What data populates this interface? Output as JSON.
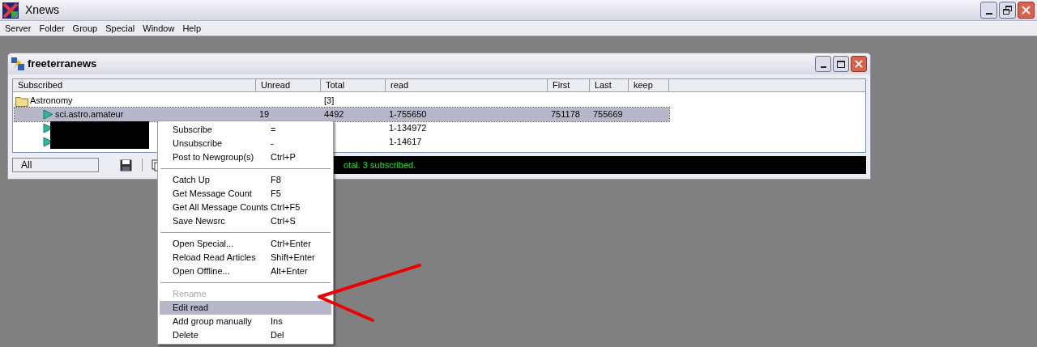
{
  "window": {
    "title": "Xnews"
  },
  "menubar": [
    "Server",
    "Folder",
    "Group",
    "Special",
    "Window",
    "Help"
  ],
  "child_window": {
    "title": "freeterranews"
  },
  "table": {
    "columns": [
      "Subscribed",
      "Unread",
      "Total",
      "read",
      "First",
      "Last",
      "keep"
    ],
    "rows": [
      {
        "kind": "folder",
        "name": "Astronomy",
        "total": "[3]",
        "selected": false
      },
      {
        "kind": "group",
        "name": "sci.astro.amateur",
        "unread": "19",
        "total": "4492",
        "read": "1-755650",
        "first": "751178",
        "last": "755669",
        "selected": true
      },
      {
        "kind": "group",
        "redacted": true,
        "read": "1-134972",
        "selected": false
      },
      {
        "kind": "group",
        "redacted": true,
        "read": "1-14617",
        "selected": false
      }
    ]
  },
  "toolbar": {
    "filter": "All"
  },
  "status_bar": "otal. 3 subscribed.",
  "context_menu": [
    {
      "kind": "item",
      "label": "Subscribe",
      "shortcut": "=",
      "disabled": false,
      "selected": false
    },
    {
      "kind": "item",
      "label": "Unsubscribe",
      "shortcut": "-",
      "disabled": false,
      "selected": false
    },
    {
      "kind": "item",
      "label": "Post to Newgroup(s)",
      "shortcut": "Ctrl+P",
      "disabled": false,
      "selected": false
    },
    {
      "kind": "separator"
    },
    {
      "kind": "item",
      "label": "Catch Up",
      "shortcut": "F8",
      "disabled": false,
      "selected": false
    },
    {
      "kind": "item",
      "label": "Get Message Count",
      "shortcut": "F5",
      "disabled": false,
      "selected": false
    },
    {
      "kind": "item",
      "label": "Get All Message Counts",
      "shortcut": "Ctrl+F5",
      "disabled": false,
      "selected": false
    },
    {
      "kind": "item",
      "label": "Save Newsrc",
      "shortcut": "Ctrl+S",
      "disabled": false,
      "selected": false
    },
    {
      "kind": "separator"
    },
    {
      "kind": "item",
      "label": "Open Special...",
      "shortcut": "Ctrl+Enter",
      "disabled": false,
      "selected": false
    },
    {
      "kind": "item",
      "label": "Reload Read Articles",
      "shortcut": "Shift+Enter",
      "disabled": false,
      "selected": false
    },
    {
      "kind": "item",
      "label": "Open Offline...",
      "shortcut": "Alt+Enter",
      "disabled": false,
      "selected": false
    },
    {
      "kind": "separator"
    },
    {
      "kind": "item",
      "label": "Rename",
      "disabled": true,
      "selected": false
    },
    {
      "kind": "item",
      "label": "Edit read",
      "disabled": false,
      "selected": true
    },
    {
      "kind": "item",
      "label": "Add group manually",
      "shortcut": "Ins",
      "disabled": false,
      "selected": false
    },
    {
      "kind": "item",
      "label": "Delete",
      "shortcut": "Del",
      "disabled": false,
      "selected": false
    }
  ]
}
